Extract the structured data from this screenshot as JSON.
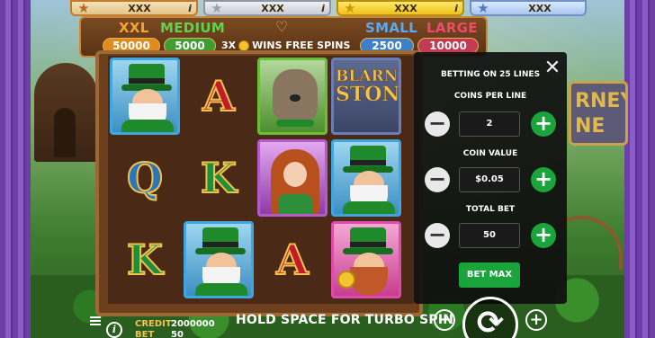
{
  "jackpots": [
    {
      "tier": "bronze",
      "value": "XXX",
      "info": "i"
    },
    {
      "tier": "silver",
      "value": "XXX",
      "info": "i"
    },
    {
      "tier": "gold",
      "value": "XXX",
      "info": "i"
    },
    {
      "tier": "blue",
      "value": "XXX",
      "info": "i"
    }
  ],
  "header": {
    "xxl_label": "XXL",
    "xxl_value": "50000",
    "medium_label": "MEDIUM",
    "medium_value": "5000",
    "small_label": "SMALL",
    "small_value": "2500",
    "large_label": "LARGE",
    "large_value": "10000",
    "wins_left": "3X",
    "wins_right": "WINS FREE SPINS"
  },
  "reels": {
    "letters": {
      "r0c1": "A",
      "r1c0": "Q",
      "r1c1": "K",
      "r2c0": "K",
      "r2c2": "A"
    },
    "stone_top": "BLARNEY",
    "stone_bottom": "STONE"
  },
  "bet_panel": {
    "title": "BETTING ON 25 LINES",
    "coins_per_line_label": "COINS PER LINE",
    "coins_per_line_value": "2",
    "coin_value_label": "COIN VALUE",
    "coin_value_value": "$0.05",
    "total_bet_label": "TOTAL BET",
    "total_bet_value": "50",
    "bet_max_label": "BET MAX",
    "close_glyph": "✕",
    "minus_glyph": "−",
    "plus_glyph": "+"
  },
  "background_sign": {
    "line1": "RNEY",
    "line2": "NE"
  },
  "bottom": {
    "credit_label": "CREDIT",
    "credit_value": "2000000",
    "bet_label": "BET",
    "bet_value": "50",
    "turbo_hint": "HOLD SPACE FOR TURBO SPIN",
    "minus_glyph": "−",
    "plus_glyph": "+",
    "spin_glyph": "⟳",
    "info_glyph": "i"
  },
  "colors": {
    "accent_green": "#1aa43c",
    "panel_bg": "#0f0f0f",
    "label_gold": "#f2c14e"
  }
}
